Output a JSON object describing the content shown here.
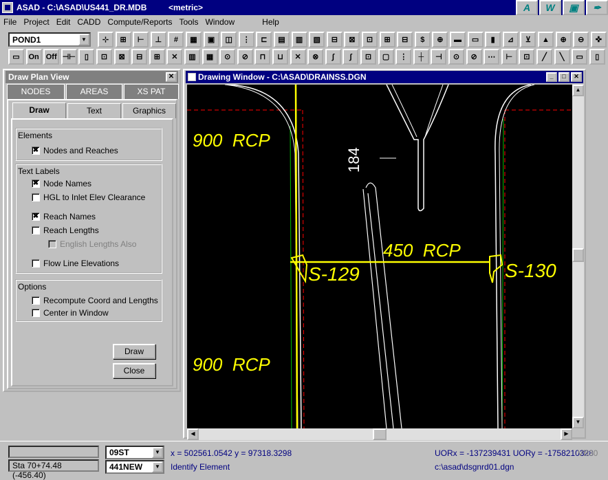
{
  "app": {
    "title": "ASAD - C:\\ASAD\\US441_DR.MDB",
    "unit_tag": "<metric>"
  },
  "title_tools": [
    "A",
    "W",
    "▣",
    "✒"
  ],
  "menu": [
    "File",
    "Project",
    "Edit",
    "CADD",
    "Compute/Reports",
    "Tools",
    "Window",
    "Help"
  ],
  "toolbar": {
    "pond_select": "POND1"
  },
  "draw_panel": {
    "title": "Draw Plan View",
    "tabs": [
      "NODES",
      "AREAS",
      "XS PAT"
    ],
    "subtabs": [
      "Draw",
      "Text",
      "Graphics"
    ],
    "elements_group": "Elements",
    "elements": [
      {
        "label": "Nodes and Reaches",
        "checked": "✖"
      }
    ],
    "text_labels_group": "Text Labels",
    "text_labels": [
      {
        "label": "Node Names",
        "checked": "✖"
      },
      {
        "label": "HGL to Inlet Elev Clearance",
        "checked": ""
      },
      {
        "label": "Reach Names",
        "checked": "✖"
      },
      {
        "label": "Reach Lengths",
        "checked": ""
      },
      {
        "label": "English Lengths Also",
        "checked": ""
      },
      {
        "label": "Flow Line Elevations",
        "checked": ""
      }
    ],
    "options_group": "Options",
    "options": [
      {
        "label": "Recompute Coord and Lengths",
        "checked": ""
      },
      {
        "label": "Center in Window",
        "checked": ""
      }
    ],
    "draw_button": "Draw",
    "close_button": "Close"
  },
  "drawing_window": {
    "title": "Drawing Window - C:\\ASAD\\DRAINSS.DGN",
    "labels": {
      "pipe_top": "900  RCP",
      "pipe_bottom": "900  RCP",
      "pipe_middle": "450  RCP",
      "node_left": "S-129",
      "node_right": "S-130",
      "station": "184"
    },
    "colors": {
      "cad_text": "#ffff00",
      "cad_lines": "#ffffff",
      "cad_green": "#00c000",
      "cad_red": "#ff0000"
    }
  },
  "status": {
    "station_offset": "Sta 70+74.48 (-456.40)",
    "combo1": "09ST",
    "combo2": "441NEW",
    "xy": "x = 502561.0542 y = 97318.3298",
    "mode": "Identify Element",
    "uor": "UORx = -137239431  UORy = -1758210328",
    "version": "VB30",
    "seed_file": "c:\\asad\\dsgnrd01.dgn"
  }
}
